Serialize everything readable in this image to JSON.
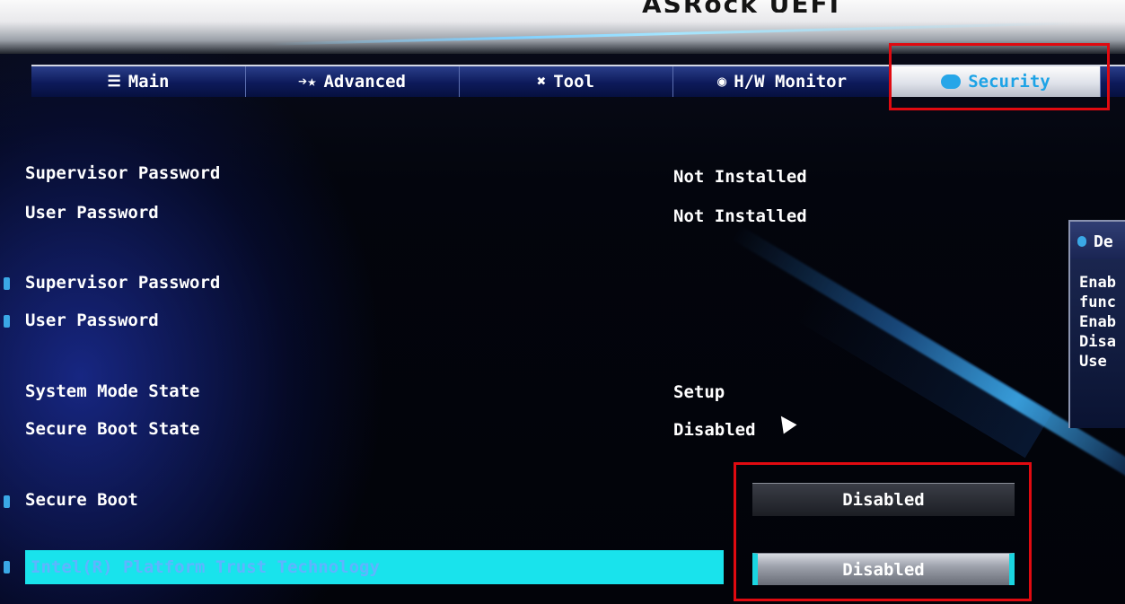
{
  "header": {
    "logo_text": "ASRock UEFI"
  },
  "tabs": [
    {
      "label": "Main",
      "icon": "list-icon"
    },
    {
      "label": "Advanced",
      "icon": "star-icon"
    },
    {
      "label": "Tool",
      "icon": "tools-icon"
    },
    {
      "label": "H/W Monitor",
      "icon": "monitor-icon"
    },
    {
      "label": "Security",
      "icon": "shield-icon",
      "active": true
    }
  ],
  "security": {
    "supervisor_password_label": "Supervisor Password",
    "supervisor_password_value": "Not Installed",
    "user_password_label": "User Password",
    "user_password_value": "Not Installed",
    "set_supervisor_password_label": "Supervisor Password",
    "set_user_password_label": "User Password",
    "system_mode_state_label": "System Mode State",
    "system_mode_state_value": "Setup",
    "secure_boot_state_label": "Secure Boot State",
    "secure_boot_state_value": "Disabled",
    "secure_boot_label": "Secure Boot",
    "secure_boot_value": "Disabled",
    "ptt_label": "Intel(R) Platform Trust Technology",
    "ptt_value": "Disabled"
  },
  "help_panel": {
    "title": "De",
    "lines": [
      "Enab",
      "func",
      "Enab",
      "Disa",
      "Use"
    ]
  },
  "colors": {
    "accent": "#1da3e6",
    "selection": "#19e3ec",
    "highlight_box": "#e00a10"
  }
}
